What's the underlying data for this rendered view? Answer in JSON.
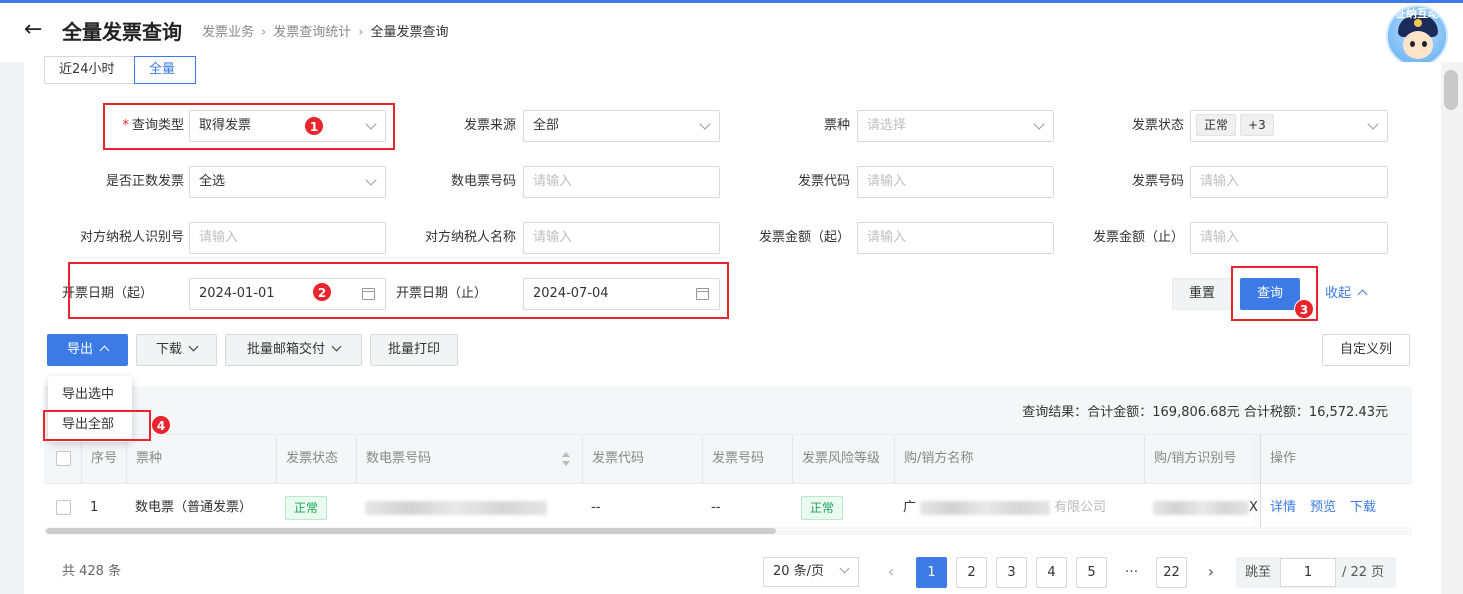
{
  "header": {
    "title": "全量发票查询",
    "breadcrumbs": [
      "发票业务",
      "发票查询统计",
      "全量发票查询"
    ],
    "avatar_text": "征纳互动"
  },
  "quick_tabs": [
    {
      "label": "近24小时",
      "active": false
    },
    {
      "label": "全量",
      "active": true
    }
  ],
  "filters": {
    "query_type": {
      "label": "查询类型",
      "required": true,
      "value": "取得发票"
    },
    "source": {
      "label": "发票来源",
      "value": "全部"
    },
    "ticket_type": {
      "label": "票种",
      "placeholder": "请选择"
    },
    "status": {
      "label": "发票状态",
      "tag": "正常",
      "more": "+3"
    },
    "is_positive": {
      "label": "是否正数发票",
      "value": "全选"
    },
    "digital_no": {
      "label": "数电票号码",
      "placeholder": "请输入"
    },
    "code": {
      "label": "发票代码",
      "placeholder": "请输入"
    },
    "number": {
      "label": "发票号码",
      "placeholder": "请输入"
    },
    "counter_taxid": {
      "label": "对方纳税人识别号",
      "placeholder": "请输入"
    },
    "counter_name": {
      "label": "对方纳税人名称",
      "placeholder": "请输入"
    },
    "amount_from": {
      "label": "发票金额（起）",
      "placeholder": "请输入"
    },
    "amount_to": {
      "label": "发票金额（止）",
      "placeholder": "请输入"
    },
    "date_from": {
      "label": "开票日期（起）",
      "value": "2024-01-01"
    },
    "date_to": {
      "label": "开票日期（止）",
      "value": "2024-07-04"
    }
  },
  "actions": {
    "reset": "重置",
    "query": "查询",
    "collapse": "收起"
  },
  "toolbar": {
    "export": "导出",
    "download": "下载",
    "batch_mail": "批量邮箱交付",
    "batch_print": "批量打印",
    "custom_columns": "自定义列"
  },
  "export_menu": [
    "导出选中",
    "导出全部"
  ],
  "step_badges": [
    "1",
    "2",
    "3",
    "4"
  ],
  "summary": "查询结果：合计金额：169,806.68元    合计税额：16,572.43元",
  "table": {
    "columns": [
      "序号",
      "票种",
      "发票状态",
      "数电票号码",
      "发票代码",
      "发票号码",
      "发票风险等级",
      "购/销方名称",
      "购/销方识别号",
      "操作"
    ],
    "rows": [
      {
        "index": "1",
        "type": "数电票（普通发票）",
        "status": "正常",
        "code": "--",
        "number": "--",
        "risk": "正常",
        "name_start": "广",
        "name_end": "有限公司",
        "taxid_end": "X",
        "ops": [
          "详情",
          "预览",
          "下载"
        ]
      }
    ]
  },
  "pagination": {
    "total": "共 428 条",
    "page_size": "20 条/页",
    "pages": [
      "1",
      "2",
      "3",
      "4",
      "5",
      "22"
    ],
    "ellipsis": "···",
    "current": "1",
    "jump_label": "跳至",
    "jump_value": "1",
    "jump_suffix": "/ 22 页"
  }
}
